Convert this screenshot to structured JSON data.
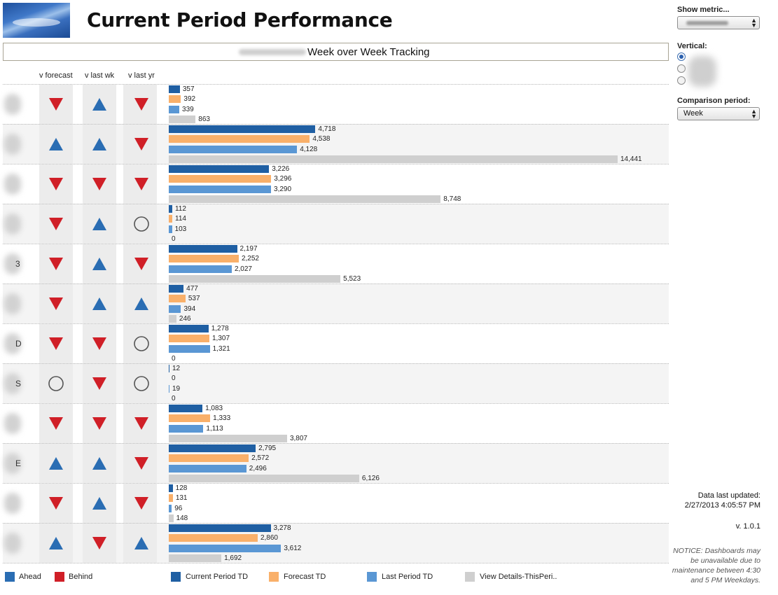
{
  "header": {
    "title": "Current Period Performance"
  },
  "banner": {
    "title": "Week over Week Tracking"
  },
  "columns": {
    "v_forecast": "v forecast",
    "v_last_wk": "v last wk",
    "v_last_yr": "v last yr"
  },
  "colors": {
    "current": "#1f5fa3",
    "forecast": "#f9b06a",
    "last_period": "#5a97d4",
    "details": "#cfcfcf",
    "ahead": "#2a6db3",
    "behind": "#d01f27",
    "neutral_ring": "#555555"
  },
  "panel": {
    "show_metric_label": "Show metric...",
    "vertical_label": "Vertical:",
    "comparison_label": "Comparison period:",
    "comparison_value": "Week",
    "data_updated_label": "Data last updated:",
    "data_updated_value": "2/27/2013 4:05:57 PM",
    "version": "v. 1.0.1",
    "notice": "NOTICE: Dashboards may be unavailable due to maintenance between 4:30 and 5 PM Weekdays."
  },
  "legend": {
    "ahead": "Ahead",
    "behind": "Behind",
    "current": "Current Period TD",
    "forecast": "Forecast TD",
    "last_period": "Last Period TD",
    "details": "View Details-ThisPeri.."
  },
  "chart_data": {
    "type": "bar",
    "orientation": "horizontal",
    "grid": false,
    "series_names": [
      "Current Period TD",
      "Forecast TD",
      "Last Period TD",
      "View Details-ThisPeri.."
    ],
    "rows": [
      {
        "fragment": "",
        "v_forecast": "behind",
        "v_last_wk": "ahead",
        "v_last_yr": "behind",
        "values": [
          357,
          392,
          339,
          863
        ],
        "labels": [
          "357",
          "392",
          "339",
          "863"
        ]
      },
      {
        "fragment": "",
        "v_forecast": "ahead",
        "v_last_wk": "ahead",
        "v_last_yr": "behind",
        "values": [
          4718,
          4538,
          4128,
          14441
        ],
        "labels": [
          "4,718",
          "4,538",
          "4,128",
          "14,441"
        ]
      },
      {
        "fragment": "",
        "v_forecast": "behind",
        "v_last_wk": "behind",
        "v_last_yr": "behind",
        "values": [
          3226,
          3296,
          3290,
          8748
        ],
        "labels": [
          "3,226",
          "3,296",
          "3,290",
          "8,748"
        ]
      },
      {
        "fragment": "",
        "v_forecast": "behind",
        "v_last_wk": "ahead",
        "v_last_yr": "neutral",
        "values": [
          112,
          114,
          103,
          0
        ],
        "labels": [
          "112",
          "114",
          "103",
          "0"
        ]
      },
      {
        "fragment": "3",
        "v_forecast": "behind",
        "v_last_wk": "ahead",
        "v_last_yr": "behind",
        "values": [
          2197,
          2252,
          2027,
          5523
        ],
        "labels": [
          "2,197",
          "2,252",
          "2,027",
          "5,523"
        ]
      },
      {
        "fragment": "",
        "v_forecast": "behind",
        "v_last_wk": "ahead",
        "v_last_yr": "ahead",
        "values": [
          477,
          537,
          394,
          246
        ],
        "labels": [
          "477",
          "537",
          "394",
          "246"
        ]
      },
      {
        "fragment": "D",
        "v_forecast": "behind",
        "v_last_wk": "behind",
        "v_last_yr": "neutral",
        "values": [
          1278,
          1307,
          1321,
          0
        ],
        "labels": [
          "1,278",
          "1,307",
          "1,321",
          "0"
        ]
      },
      {
        "fragment": "S",
        "v_forecast": "neutral",
        "v_last_wk": "behind",
        "v_last_yr": "neutral",
        "values": [
          12,
          0,
          19,
          0
        ],
        "labels": [
          "12",
          "0",
          "19",
          "0"
        ]
      },
      {
        "fragment": "",
        "v_forecast": "behind",
        "v_last_wk": "behind",
        "v_last_yr": "behind",
        "values": [
          1083,
          1333,
          1113,
          3807
        ],
        "labels": [
          "1,083",
          "1,333",
          "1,113",
          "3,807"
        ]
      },
      {
        "fragment": "E",
        "v_forecast": "ahead",
        "v_last_wk": "ahead",
        "v_last_yr": "behind",
        "values": [
          2795,
          2572,
          2496,
          6126
        ],
        "labels": [
          "2,795",
          "2,572",
          "2,496",
          "6,126"
        ]
      },
      {
        "fragment": "",
        "v_forecast": "behind",
        "v_last_wk": "ahead",
        "v_last_yr": "behind",
        "values": [
          128,
          131,
          96,
          148
        ],
        "labels": [
          "128",
          "131",
          "96",
          "148"
        ]
      },
      {
        "fragment": "",
        "v_forecast": "ahead",
        "v_last_wk": "behind",
        "v_last_yr": "ahead",
        "values": [
          3278,
          2860,
          3612,
          1692
        ],
        "labels": [
          "3,278",
          "2,860",
          "3,612",
          "1,692"
        ]
      }
    ],
    "x_max": 14441
  }
}
